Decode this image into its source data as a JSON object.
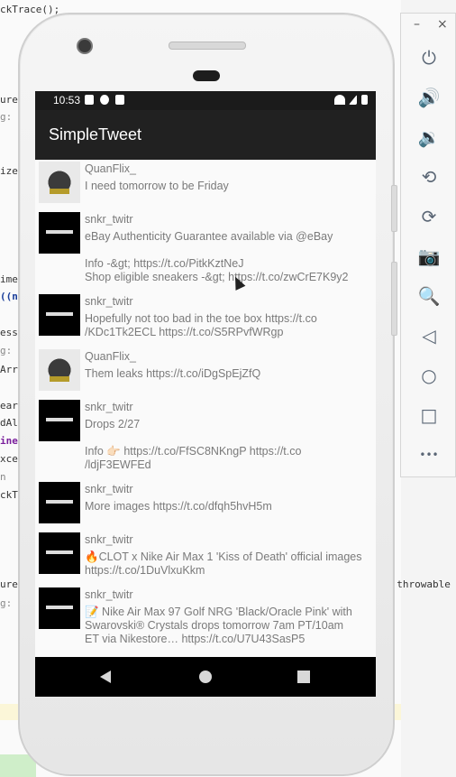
{
  "editor": {
    "lines": [
      {
        "text": "ckTrace();",
        "cls": ""
      },
      {
        "text": "ure",
        "cls": ""
      },
      {
        "text": "g:",
        "cls": "gray"
      },
      {
        "text": "ize",
        "cls": ""
      },
      {
        "text": "ime",
        "cls": ""
      },
      {
        "text": "((n",
        "cls": "blue"
      },
      {
        "text": "ess",
        "cls": ""
      },
      {
        "text": "g:",
        "cls": "gray"
      },
      {
        "text": "Arr",
        "cls": ""
      },
      {
        "text": "ear",
        "cls": ""
      },
      {
        "text": "dAl",
        "cls": ""
      },
      {
        "text": "ine",
        "cls": "kw"
      },
      {
        "text": "xce",
        "cls": ""
      },
      {
        "text": "n",
        "cls": "gray"
      },
      {
        "text": "ckT",
        "cls": ""
      },
      {
        "text": "ure",
        "cls": ""
      },
      {
        "text": "g:",
        "cls": "gray"
      }
    ],
    "right_lines": [
      {
        "text": "e"
      },
      {
        "text": "e throwable"
      }
    ]
  },
  "toolbar": {
    "minimize": "–",
    "close": "×",
    "buttons": [
      {
        "name": "power-icon",
        "glyph": "⏻"
      },
      {
        "name": "volume-up-icon",
        "glyph": "🔊"
      },
      {
        "name": "volume-down-icon",
        "glyph": "🔉"
      },
      {
        "name": "rotate-left-icon",
        "glyph": "⟲"
      },
      {
        "name": "rotate-right-icon",
        "glyph": "⟳"
      },
      {
        "name": "camera-icon",
        "glyph": "📷"
      },
      {
        "name": "zoom-icon",
        "glyph": "🔍"
      },
      {
        "name": "back-icon",
        "glyph": "◁"
      },
      {
        "name": "home-icon",
        "glyph": "○"
      },
      {
        "name": "overview-icon",
        "glyph": "□"
      },
      {
        "name": "more-icon",
        "glyph": "•••"
      }
    ]
  },
  "status": {
    "time": "10:53"
  },
  "app": {
    "title": "SimpleTweet"
  },
  "tweets": [
    {
      "user": "QuanFlix_",
      "avatar": "quanflix",
      "body": "I need tomorrow to be Friday"
    },
    {
      "user": "snkr_twitr",
      "avatar": "snkr",
      "body": "eBay Authenticity Guarantee available via @eBay\n\nInfo -&gt; https://t.co/PitkKztNeJ\nShop eligible sneakers -&gt; https://t.co/zwCrE7K9y2"
    },
    {
      "user": "snkr_twitr",
      "avatar": "snkr",
      "body": "Hopefully not too bad in the toe box https://t.co\n/KDc1Tk2ECL https://t.co/S5RPvfWRgp"
    },
    {
      "user": "QuanFlix_",
      "avatar": "quanflix",
      "body": "Them leaks https://t.co/iDgSpEjZfQ"
    },
    {
      "user": "snkr_twitr",
      "avatar": "snkr",
      "body": "Drops 2/27\n\nInfo 👉🏻 https://t.co/FfSC8NKngP https://t.co\n/ldjF3EWFEd"
    },
    {
      "user": "snkr_twitr",
      "avatar": "snkr",
      "body": "More images https://t.co/dfqh5hvH5m"
    },
    {
      "user": "snkr_twitr",
      "avatar": "snkr",
      "body": "🔥CLOT x Nike Air Max 1 'Kiss of Death' official images\nhttps://t.co/1DuVlxuKkm"
    },
    {
      "user": "snkr_twitr",
      "avatar": "snkr",
      "body": "📝 Nike Air Max 97 Golf NRG 'Black/Oracle Pink' with\nSwarovski® Crystals drops tomorrow 7am PT/10am\nET via Nikestore… https://t.co/U7U43SasP5"
    }
  ]
}
